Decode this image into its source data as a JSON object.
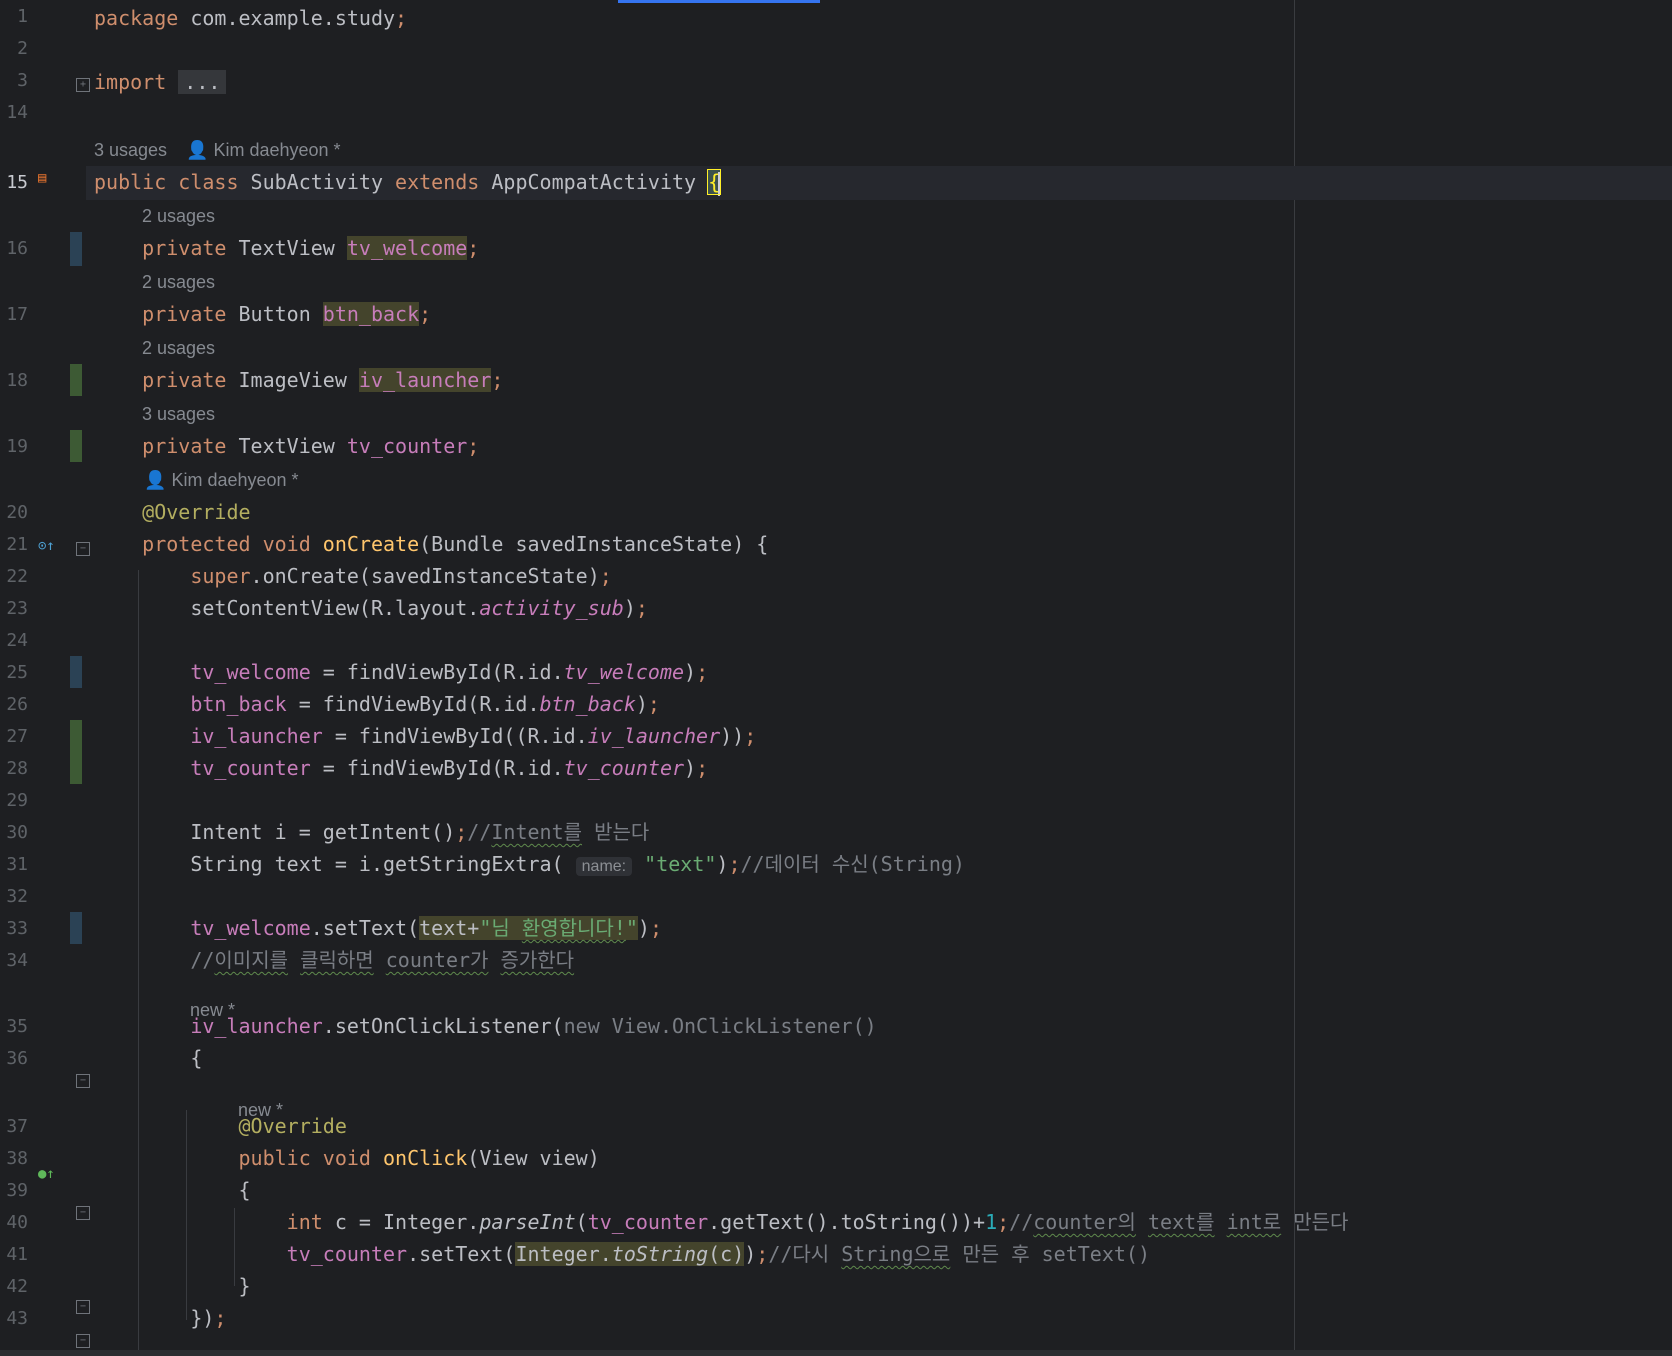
{
  "editor": {
    "lines": [
      {
        "n": "1",
        "segs": [
          [
            "kw",
            "package "
          ],
          [
            "",
            "com.example.study"
          ],
          [
            "kw",
            ";"
          ]
        ]
      },
      {
        "n": "2",
        "segs": []
      },
      {
        "n": "3",
        "segs": [
          [
            "kw",
            "import "
          ],
          [
            "fold-box",
            "..."
          ]
        ]
      },
      {
        "n": "14",
        "segs": []
      },
      {
        "n": "15",
        "segs": [
          [
            "kw",
            "public class "
          ],
          [
            "",
            "SubActivity "
          ],
          [
            "kw",
            "extends "
          ],
          [
            "",
            "AppCompatActivity "
          ],
          [
            "brace-hl",
            "{"
          ]
        ]
      },
      {
        "n": "16",
        "segs": [
          [
            "",
            "    "
          ],
          [
            "kw",
            "private "
          ],
          [
            "",
            "TextView "
          ],
          [
            "fld hl",
            "tv_welcome"
          ],
          [
            "kw",
            ";"
          ]
        ]
      },
      {
        "n": "17",
        "segs": [
          [
            "",
            "    "
          ],
          [
            "kw",
            "private "
          ],
          [
            "",
            "Button "
          ],
          [
            "fld hl",
            "btn_back"
          ],
          [
            "kw",
            ";"
          ]
        ]
      },
      {
        "n": "18",
        "segs": [
          [
            "",
            "    "
          ],
          [
            "kw",
            "private "
          ],
          [
            "",
            "ImageView "
          ],
          [
            "fld hl",
            "iv_launcher"
          ],
          [
            "kw",
            ";"
          ]
        ]
      },
      {
        "n": "19",
        "segs": [
          [
            "",
            "    "
          ],
          [
            "kw",
            "private "
          ],
          [
            "",
            "TextView "
          ],
          [
            "fld",
            "tv_counter"
          ],
          [
            "kw",
            ";"
          ]
        ]
      },
      {
        "n": "20",
        "segs": [
          [
            "",
            "    "
          ],
          [
            "ann",
            "@Override"
          ]
        ]
      },
      {
        "n": "21",
        "segs": [
          [
            "",
            "    "
          ],
          [
            "kw",
            "protected void "
          ],
          [
            "meth",
            "onCreate"
          ],
          [
            "",
            "(Bundle savedInstanceState) {"
          ]
        ]
      },
      {
        "n": "22",
        "segs": [
          [
            "",
            "        "
          ],
          [
            "kw",
            "super"
          ],
          [
            "",
            ".onCreate(savedInstanceState)"
          ],
          [
            "kw",
            ";"
          ]
        ]
      },
      {
        "n": "23",
        "segs": [
          [
            "",
            "        setContentView(R.layout."
          ],
          [
            "sta",
            "activity_sub"
          ],
          [
            "",
            ")"
          ],
          [
            "kw",
            ";"
          ]
        ]
      },
      {
        "n": "24",
        "segs": []
      },
      {
        "n": "25",
        "segs": [
          [
            "",
            "        "
          ],
          [
            "fld",
            "tv_welcome"
          ],
          [
            "",
            " = findViewById(R.id."
          ],
          [
            "sta",
            "tv_welcome"
          ],
          [
            "",
            ")"
          ],
          [
            "kw",
            ";"
          ]
        ]
      },
      {
        "n": "26",
        "segs": [
          [
            "",
            "        "
          ],
          [
            "fld",
            "btn_back"
          ],
          [
            "",
            " = findViewById(R.id."
          ],
          [
            "sta",
            "btn_back"
          ],
          [
            "",
            ")"
          ],
          [
            "kw",
            ";"
          ]
        ]
      },
      {
        "n": "27",
        "segs": [
          [
            "",
            "        "
          ],
          [
            "fld",
            "iv_launcher"
          ],
          [
            "",
            " = findViewById((R.id."
          ],
          [
            "sta",
            "iv_launcher"
          ],
          [
            "",
            "))"
          ],
          [
            "kw",
            ";"
          ]
        ]
      },
      {
        "n": "28",
        "segs": [
          [
            "",
            "        "
          ],
          [
            "fld",
            "tv_counter"
          ],
          [
            "",
            " = findViewById(R.id."
          ],
          [
            "sta",
            "tv_counter"
          ],
          [
            "",
            ")"
          ],
          [
            "kw",
            ";"
          ]
        ]
      },
      {
        "n": "29",
        "segs": []
      },
      {
        "n": "30",
        "segs": [
          [
            "",
            "        Intent i = getIntent()"
          ],
          [
            "kw",
            ";"
          ],
          [
            "cmt",
            "//"
          ],
          [
            "cmt sq",
            "Intent를"
          ],
          [
            "cmt",
            " 받는다"
          ]
        ]
      },
      {
        "n": "31",
        "segs": [
          [
            "",
            "        String text = i.getStringExtra( "
          ],
          [
            "param-hint",
            "name:"
          ],
          [
            "",
            " "
          ],
          [
            "str",
            "\"text\""
          ],
          [
            "",
            ")"
          ],
          [
            "kw",
            ";"
          ],
          [
            "cmt",
            "//데이터 수신(String)"
          ]
        ]
      },
      {
        "n": "32",
        "segs": []
      },
      {
        "n": "33",
        "segs": [
          [
            "",
            "        "
          ],
          [
            "fld",
            "tv_welcome"
          ],
          [
            "",
            ".setText("
          ],
          [
            "hl",
            "text+"
          ],
          [
            "str hl",
            "\"님 "
          ],
          [
            "str hl sq",
            "환영합니다!"
          ],
          [
            "str hl",
            "\""
          ],
          [
            "",
            ")"
          ],
          [
            "kw",
            ";"
          ]
        ]
      },
      {
        "n": "34",
        "segs": [
          [
            "",
            "        "
          ],
          [
            "cmt",
            "//"
          ],
          [
            "cmt sq",
            "이미지를"
          ],
          [
            "cmt",
            " "
          ],
          [
            "cmt sq",
            "클릭하면"
          ],
          [
            "cmt",
            " "
          ],
          [
            "cmt sq",
            "counter가"
          ],
          [
            "cmt",
            " "
          ],
          [
            "cmt sq",
            "증가한다"
          ]
        ]
      },
      {
        "n": "35",
        "segs": [
          [
            "",
            "        "
          ],
          [
            "fld",
            "iv_launcher"
          ],
          [
            "",
            ".setOnClickListener("
          ],
          [
            "dim",
            "new View.OnClickListener()"
          ]
        ]
      },
      {
        "n": "36",
        "segs": [
          [
            "",
            "        {"
          ]
        ]
      },
      {
        "n": "37",
        "segs": [
          [
            "",
            "            "
          ],
          [
            "ann",
            "@Override"
          ]
        ]
      },
      {
        "n": "38",
        "segs": [
          [
            "",
            "            "
          ],
          [
            "kw",
            "public void "
          ],
          [
            "meth",
            "onClick"
          ],
          [
            "",
            "(View view)"
          ]
        ]
      },
      {
        "n": "39",
        "segs": [
          [
            "",
            "            {"
          ]
        ]
      },
      {
        "n": "40",
        "segs": [
          [
            "",
            "                "
          ],
          [
            "kw",
            "int "
          ],
          [
            "",
            "c = Integer."
          ],
          [
            "it",
            "parseInt"
          ],
          [
            "",
            "("
          ],
          [
            "fld",
            "tv_counter"
          ],
          [
            "",
            ".getText().toString())+"
          ],
          [
            "num",
            "1"
          ],
          [
            "kw",
            ";"
          ],
          [
            "cmt",
            "//"
          ],
          [
            "cmt sq",
            "counter의"
          ],
          [
            "cmt",
            " "
          ],
          [
            "cmt sq",
            "text를"
          ],
          [
            "cmt",
            " "
          ],
          [
            "cmt sq",
            "int로"
          ],
          [
            "cmt",
            " 만든다"
          ]
        ]
      },
      {
        "n": "41",
        "segs": [
          [
            "",
            "                "
          ],
          [
            "fld",
            "tv_counter"
          ],
          [
            "",
            ".setText("
          ],
          [
            "hl",
            "Integer."
          ],
          [
            "hl it",
            "toString"
          ],
          [
            "hl",
            "(c)"
          ],
          [
            "",
            ")"
          ],
          [
            "kw",
            ";"
          ],
          [
            "cmt",
            "//다시 "
          ],
          [
            "cmt sq",
            "String으로"
          ],
          [
            "cmt",
            " 만든 후 setText()"
          ]
        ]
      },
      {
        "n": "42",
        "segs": [
          [
            "",
            "            }"
          ]
        ]
      },
      {
        "n": "43",
        "segs": [
          [
            "",
            "        })"
          ],
          [
            "kw",
            ";"
          ]
        ]
      }
    ],
    "hints": {
      "h14": "3 usages",
      "h14_author": "Kim daehyeon *",
      "h15": "2 usages",
      "h16": "2 usages",
      "h17": "2 usages",
      "h18": "3 usages",
      "h19_author": "Kim daehyeon *",
      "h34": "new *",
      "h36": "new *"
    }
  },
  "colors": {
    "background": "#1e1f22",
    "keyword": "#cf8e6d",
    "field": "#c77dba",
    "string": "#6aab73",
    "annotation": "#b3ae60",
    "comment": "#7a7e85",
    "method": "#ffc66d",
    "change_added": "#3d5a34",
    "change_modified": "#2b4255"
  }
}
